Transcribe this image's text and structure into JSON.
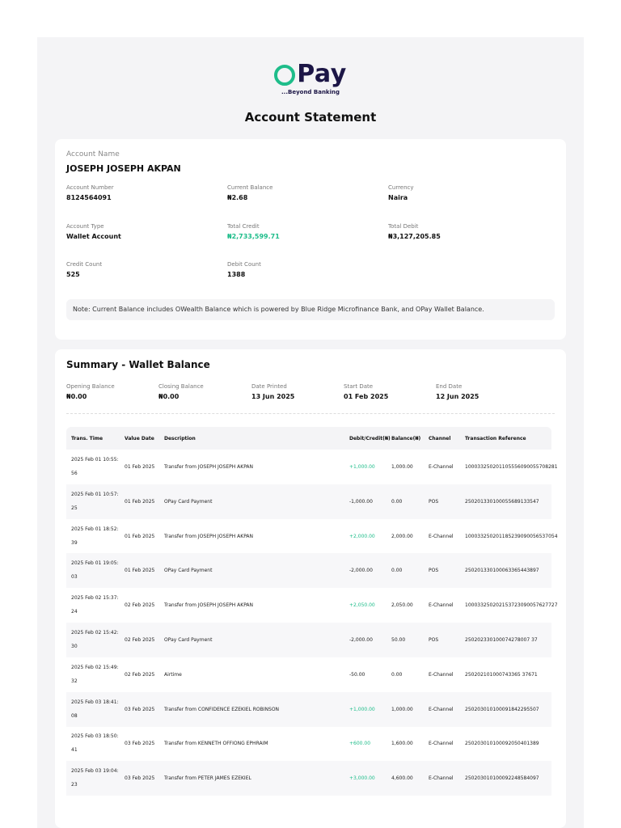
{
  "brand": {
    "name": "Pay",
    "tagline": "...Beyond Banking",
    "accent": "#1ebd8a",
    "navy": "#1c1646"
  },
  "title": "Account Statement",
  "account": {
    "name_label": "Account Name",
    "name": "JOSEPH JOSEPH AKPAN",
    "fields": [
      {
        "label": "Account Number",
        "value": "8124564091"
      },
      {
        "label": "Current Balance",
        "value": "₦2.68"
      },
      {
        "label": "Currency",
        "value": "Naira"
      },
      {
        "label": "Account Type",
        "value": "Wallet Account"
      },
      {
        "label": "Total Credit",
        "value": "₦2,733,599.71"
      },
      {
        "label": "Total Debit",
        "value": "₦3,127,205.85"
      },
      {
        "label": "Credit Count",
        "value": "525"
      },
      {
        "label": "Debit Count",
        "value": "1388"
      }
    ],
    "note": "Note: Current Balance includes OWealth Balance which is powered by Blue Ridge Microfinance Bank, and OPay Wallet Balance."
  },
  "summary": {
    "title": "Summary - Wallet Balance",
    "fields": [
      {
        "label": "Opening Balance",
        "value": "₦0.00"
      },
      {
        "label": "Closing Balance",
        "value": "₦0.00"
      },
      {
        "label": "Date Printed",
        "value": "13 Jun 2025"
      },
      {
        "label": "Start Date",
        "value": "01 Feb 2025"
      },
      {
        "label": "End Date",
        "value": "12 Jun 2025"
      }
    ]
  },
  "table": {
    "headers": [
      "Trans. Time",
      "Value Date",
      "Description",
      "Debit/Credit(₦)",
      "Balance(₦)",
      "Channel",
      "Transaction Reference"
    ],
    "rows": [
      {
        "time1": "2025 Feb 01 10:55:",
        "time2": "56",
        "value_date": "01 Feb 2025",
        "description": "Transfer from JOSEPH JOSEPH AKPAN",
        "amount": "+1,000.00",
        "credit": true,
        "balance": "1,000.00",
        "channel": "E-Channel",
        "reference": "100033250201105556090055708281"
      },
      {
        "time1": "2025 Feb 01 10:57:",
        "time2": "25",
        "value_date": "01 Feb 2025",
        "description": "OPay Card Payment",
        "amount": "-1,000.00",
        "credit": false,
        "balance": "0.00",
        "channel": "POS",
        "reference": "250201330100055689133547"
      },
      {
        "time1": "2025 Feb 01 18:52:",
        "time2": "39",
        "value_date": "01 Feb 2025",
        "description": "Transfer from JOSEPH JOSEPH AKPAN",
        "amount": "+2,000.00",
        "credit": true,
        "balance": "2,000.00",
        "channel": "E-Channel",
        "reference": "100033250201185239090056537054"
      },
      {
        "time1": "2025 Feb 01 19:05:",
        "time2": "03",
        "value_date": "01 Feb 2025",
        "description": "OPay Card Payment",
        "amount": "-2,000.00",
        "credit": false,
        "balance": "0.00",
        "channel": "POS",
        "reference": "250201330100063365443897"
      },
      {
        "time1": "2025 Feb 02 15:37:",
        "time2": "24",
        "value_date": "02 Feb 2025",
        "description": "Transfer from JOSEPH JOSEPH AKPAN",
        "amount": "+2,050.00",
        "credit": true,
        "balance": "2,050.00",
        "channel": "E-Channel",
        "reference": "100033250202153723090057627727"
      },
      {
        "time1": "2025 Feb 02 15:42:",
        "time2": "30",
        "value_date": "02 Feb 2025",
        "description": "OPay Card Payment",
        "amount": "-2,000.00",
        "credit": false,
        "balance": "50.00",
        "channel": "POS",
        "reference": "250202330100074278007 37"
      },
      {
        "time1": "2025 Feb 02 15:49:",
        "time2": "32",
        "value_date": "02 Feb 2025",
        "description": "Airtime",
        "amount": "-50.00",
        "credit": false,
        "balance": "0.00",
        "channel": "E-Channel",
        "reference": "250202101000743365 37671"
      },
      {
        "time1": "2025 Feb 03 18:41:",
        "time2": "08",
        "value_date": "03 Feb 2025",
        "description": "Transfer from CONFIDENCE EZEKIEL ROBINSON",
        "amount": "+1,000.00",
        "credit": true,
        "balance": "1,000.00",
        "channel": "E-Channel",
        "reference": "250203010100091842295507"
      },
      {
        "time1": "2025 Feb 03 18:50:",
        "time2": "41",
        "value_date": "03 Feb 2025",
        "description": "Transfer from KENNETH OFFIONG EPHRAIM",
        "amount": "+600.00",
        "credit": true,
        "balance": "1,600.00",
        "channel": "E-Channel",
        "reference": "250203010100092050401389"
      },
      {
        "time1": "2025 Feb 03 19:04:",
        "time2": "23",
        "value_date": "03 Feb 2025",
        "description": "Transfer from PETER JAMES EZEKIEL",
        "amount": "+3,000.00",
        "credit": true,
        "balance": "4,600.00",
        "channel": "E-Channel",
        "reference": "250203010100092248584097"
      }
    ]
  }
}
